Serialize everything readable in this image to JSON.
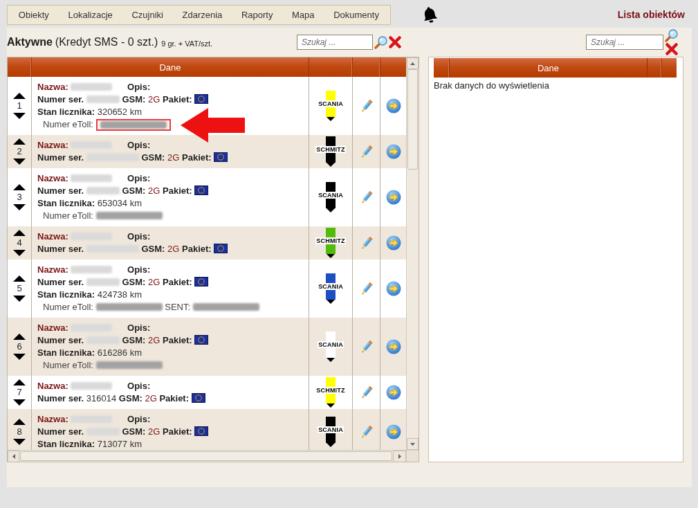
{
  "nav": [
    "Obiekty",
    "Lokalizacje",
    "Czujniki",
    "Zdarzenia",
    "Raporty",
    "Mapa",
    "Dokumenty"
  ],
  "page_title": "Lista obiektów",
  "active_list": {
    "title": "Aktywne",
    "credit": "(Kredyt SMS - 0 szt.)",
    "price_note": "9 gr. + VAT/szt.",
    "search": {
      "placeholder": "Szukaj ..."
    },
    "header_label": "Dane",
    "rows": [
      {
        "number": "1",
        "annotated": true,
        "brand": "SCANIA",
        "color": "#ffff00",
        "lines": [
          {
            "kind": "main",
            "parts": [
              {
                "kind": "name-label",
                "text": "Nazwa:"
              },
              {
                "kind": "hidden-plate"
              },
              {
                "kind": "label",
                "text": "Opis:"
              }
            ]
          },
          {
            "kind": "main",
            "parts": [
              {
                "kind": "label",
                "text": "Numer ser."
              },
              {
                "kind": "hidden-number"
              },
              {
                "kind": "label",
                "text": "GSM:"
              },
              {
                "kind": "accent",
                "text": "2G"
              },
              {
                "kind": "label",
                "text": "Pakiet:"
              },
              {
                "kind": "flag"
              }
            ]
          },
          {
            "kind": "main",
            "parts": [
              {
                "kind": "label",
                "text": "Stan licznika:"
              },
              {
                "kind": "value",
                "text": "320652 km"
              }
            ]
          },
          {
            "kind": "toll",
            "parts": [
              {
                "kind": "plain-label",
                "text": "Numer eToll:"
              },
              {
                "kind": "hidden-toll"
              }
            ]
          }
        ]
      },
      {
        "number": "2",
        "annotated": false,
        "brand": "SCHMITZ",
        "color": "#000000",
        "lines": [
          {
            "kind": "main",
            "parts": [
              {
                "kind": "name-label",
                "text": "Nazwa:"
              },
              {
                "kind": "hidden-plate"
              },
              {
                "kind": "label",
                "text": "Opis:"
              }
            ]
          },
          {
            "kind": "main",
            "parts": [
              {
                "kind": "label",
                "text": "Numer ser."
              },
              {
                "kind": "hidden-code"
              },
              {
                "kind": "label",
                "text": "GSM:"
              },
              {
                "kind": "accent",
                "text": "2G"
              },
              {
                "kind": "label",
                "text": "Pakiet:"
              },
              {
                "kind": "flag"
              }
            ]
          }
        ]
      },
      {
        "number": "3",
        "annotated": false,
        "brand": "SCANIA",
        "color": "#000000",
        "lines": [
          {
            "kind": "main",
            "parts": [
              {
                "kind": "name-label",
                "text": "Nazwa:"
              },
              {
                "kind": "hidden-plate"
              },
              {
                "kind": "label",
                "text": "Opis:"
              }
            ]
          },
          {
            "kind": "main",
            "parts": [
              {
                "kind": "label",
                "text": "Numer ser."
              },
              {
                "kind": "hidden-number"
              },
              {
                "kind": "label",
                "text": "GSM:"
              },
              {
                "kind": "accent",
                "text": "2G"
              },
              {
                "kind": "label",
                "text": "Pakiet:"
              },
              {
                "kind": "flag"
              }
            ]
          },
          {
            "kind": "main",
            "parts": [
              {
                "kind": "label",
                "text": "Stan licznika:"
              },
              {
                "kind": "value",
                "text": "653034 km"
              }
            ]
          },
          {
            "kind": "toll",
            "parts": [
              {
                "kind": "plain-label",
                "text": "Numer eToll:"
              },
              {
                "kind": "hidden-toll"
              }
            ]
          }
        ]
      },
      {
        "number": "4",
        "annotated": false,
        "brand": "SCHMITZ",
        "color": "#55bb0a",
        "lines": [
          {
            "kind": "main",
            "parts": [
              {
                "kind": "name-label",
                "text": "Nazwa:"
              },
              {
                "kind": "hidden-plate"
              },
              {
                "kind": "label",
                "text": "Opis:"
              }
            ]
          },
          {
            "kind": "main",
            "parts": [
              {
                "kind": "label",
                "text": "Numer ser."
              },
              {
                "kind": "hidden-code"
              },
              {
                "kind": "label",
                "text": "GSM:"
              },
              {
                "kind": "accent",
                "text": "2G"
              },
              {
                "kind": "label",
                "text": "Pakiet:"
              },
              {
                "kind": "flag"
              }
            ]
          }
        ]
      },
      {
        "number": "5",
        "annotated": false,
        "brand": "SCANIA",
        "color": "#1d4fc4",
        "lines": [
          {
            "kind": "main",
            "parts": [
              {
                "kind": "name-label",
                "text": "Nazwa:"
              },
              {
                "kind": "hidden-plate"
              },
              {
                "kind": "label",
                "text": "Opis:"
              }
            ]
          },
          {
            "kind": "main",
            "parts": [
              {
                "kind": "label",
                "text": "Numer ser."
              },
              {
                "kind": "hidden-number"
              },
              {
                "kind": "label",
                "text": "GSM:"
              },
              {
                "kind": "accent",
                "text": "2G"
              },
              {
                "kind": "label",
                "text": "Pakiet:"
              },
              {
                "kind": "flag"
              }
            ]
          },
          {
            "kind": "main",
            "parts": [
              {
                "kind": "label",
                "text": "Stan licznika:"
              },
              {
                "kind": "value",
                "text": "424738 km"
              }
            ]
          },
          {
            "kind": "toll",
            "parts": [
              {
                "kind": "plain-label",
                "text": "Numer eToll:"
              },
              {
                "kind": "hidden-toll"
              },
              {
                "kind": "plain-label",
                "text": "SENT:"
              },
              {
                "kind": "hidden-toll"
              }
            ]
          }
        ]
      },
      {
        "number": "6",
        "annotated": false,
        "brand": "SCANIA",
        "color": "#ffffff",
        "lines": [
          {
            "kind": "main",
            "parts": [
              {
                "kind": "name-label",
                "text": "Nazwa:"
              },
              {
                "kind": "hidden-plate"
              },
              {
                "kind": "label",
                "text": "Opis:"
              }
            ]
          },
          {
            "kind": "main",
            "parts": [
              {
                "kind": "label",
                "text": "Numer ser."
              },
              {
                "kind": "hidden-number"
              },
              {
                "kind": "label",
                "text": "GSM:"
              },
              {
                "kind": "accent",
                "text": "2G"
              },
              {
                "kind": "label",
                "text": "Pakiet:"
              },
              {
                "kind": "flag"
              }
            ]
          },
          {
            "kind": "main",
            "parts": [
              {
                "kind": "label",
                "text": "Stan licznika:"
              },
              {
                "kind": "value",
                "text": "616286 km"
              }
            ]
          },
          {
            "kind": "toll",
            "parts": [
              {
                "kind": "plain-label",
                "text": "Numer eToll:"
              },
              {
                "kind": "hidden-toll"
              }
            ]
          }
        ]
      },
      {
        "number": "7",
        "annotated": false,
        "brand": "SCHMITZ",
        "color": "#ffff00",
        "lines": [
          {
            "kind": "main",
            "parts": [
              {
                "kind": "name-label",
                "text": "Nazwa:"
              },
              {
                "kind": "hidden-plate"
              },
              {
                "kind": "label",
                "text": "Opis:"
              }
            ]
          },
          {
            "kind": "main",
            "parts": [
              {
                "kind": "label",
                "text": "Numer ser."
              },
              {
                "kind": "value",
                "text": "316014"
              },
              {
                "kind": "label",
                "text": "GSM:"
              },
              {
                "kind": "accent",
                "text": "2G"
              },
              {
                "kind": "label",
                "text": "Pakiet:"
              },
              {
                "kind": "flag"
              }
            ]
          }
        ]
      },
      {
        "number": "8",
        "annotated": false,
        "brand": "SCANIA",
        "color": "#000000",
        "lines": [
          {
            "kind": "main",
            "parts": [
              {
                "kind": "name-label",
                "text": "Nazwa:"
              },
              {
                "kind": "hidden-plate"
              },
              {
                "kind": "label",
                "text": "Opis:"
              }
            ]
          },
          {
            "kind": "main",
            "parts": [
              {
                "kind": "label",
                "text": "Numer ser."
              },
              {
                "kind": "hidden-number"
              },
              {
                "kind": "label",
                "text": "GSM:"
              },
              {
                "kind": "accent",
                "text": "2G"
              },
              {
                "kind": "label",
                "text": "Pakiet:"
              },
              {
                "kind": "flag"
              }
            ]
          },
          {
            "kind": "main",
            "parts": [
              {
                "kind": "label",
                "text": "Stan licznika:"
              },
              {
                "kind": "value",
                "text": "713077 km"
              }
            ]
          }
        ]
      }
    ]
  },
  "selected_list": {
    "search": {
      "placeholder": "Szukaj ..."
    },
    "header_label": "Dane",
    "empty_message": "Brak danych do wyświetlenia"
  }
}
